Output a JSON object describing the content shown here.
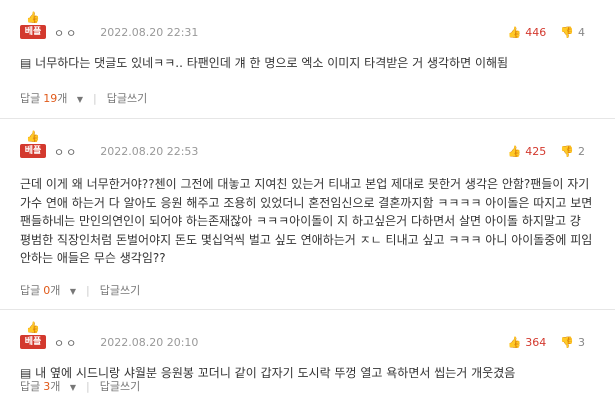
{
  "comments": [
    {
      "best_label": "베플",
      "nickname": "ㅇㅇ",
      "date": "2022.08.20 22:31",
      "up": "446",
      "down": "4",
      "text": "너무하다는 댓글도 있네ㅋㅋ.. 타팬인데 걔 한 명으로 엑소 이미지 타격받은 거 생각하면 이해됨",
      "reply_label": "답글",
      "reply_count": "19",
      "reply_unit": "개",
      "write_label": "답글쓰기"
    },
    {
      "best_label": "베플",
      "nickname": "ㅇㅇ",
      "date": "2022.08.20 22:53",
      "up": "425",
      "down": "2",
      "text": "근데 이게 왜 너무한거야??첸이 그전에 대놓고 지여친 있는거 티내고 본업 제대로 못한거 생각은 안함?팬들이 자기 가수 연애 하는거 다 알아도 응원 해주고 조용히 있었더니 혼전임신으로 결혼까지함 ㅋㅋㅋㅋ 아이돌은 따지고 보면 팬들하네는 만인의연인이 되어야 하는존재잖아 ㅋㅋㅋ아이돌이 지 하고싶은거 다하면서 살면 아이돌 하지말고 걍 평범한 직장인처럼 돈벌어야지 돈도 몇십억씩 벌고 싶도 연애하는거 ㅈㄴ 티내고 싶고 ㅋㅋㅋ 아니 아이돌중에 피임 안하는 애들은 무슨 생각임??",
      "reply_label": "답글",
      "reply_count": "0",
      "reply_unit": "개",
      "write_label": "답글쓰기"
    },
    {
      "best_label": "베플",
      "nickname": "ㅇㅇ",
      "date": "2022.08.20 20:10",
      "up": "364",
      "down": "3",
      "text": "내 옆에 시드니랑 샤월분 응원봉 꼬더니 같이 갑자기 도시락 뚜껑 열고 욕하면서 씹는거 개웃겼음",
      "reply_label": "답글",
      "reply_count": "3",
      "reply_unit": "개",
      "write_label": "답글쓰기"
    }
  ],
  "colors": {
    "accent": "#d3392e",
    "reply_count": "#e05a1a"
  },
  "icons": {
    "best": "thumbs-up-icon",
    "up": "thumbs-up-icon",
    "down": "thumbs-down-icon",
    "doc": "document-icon",
    "caret": "caret-down-icon"
  }
}
